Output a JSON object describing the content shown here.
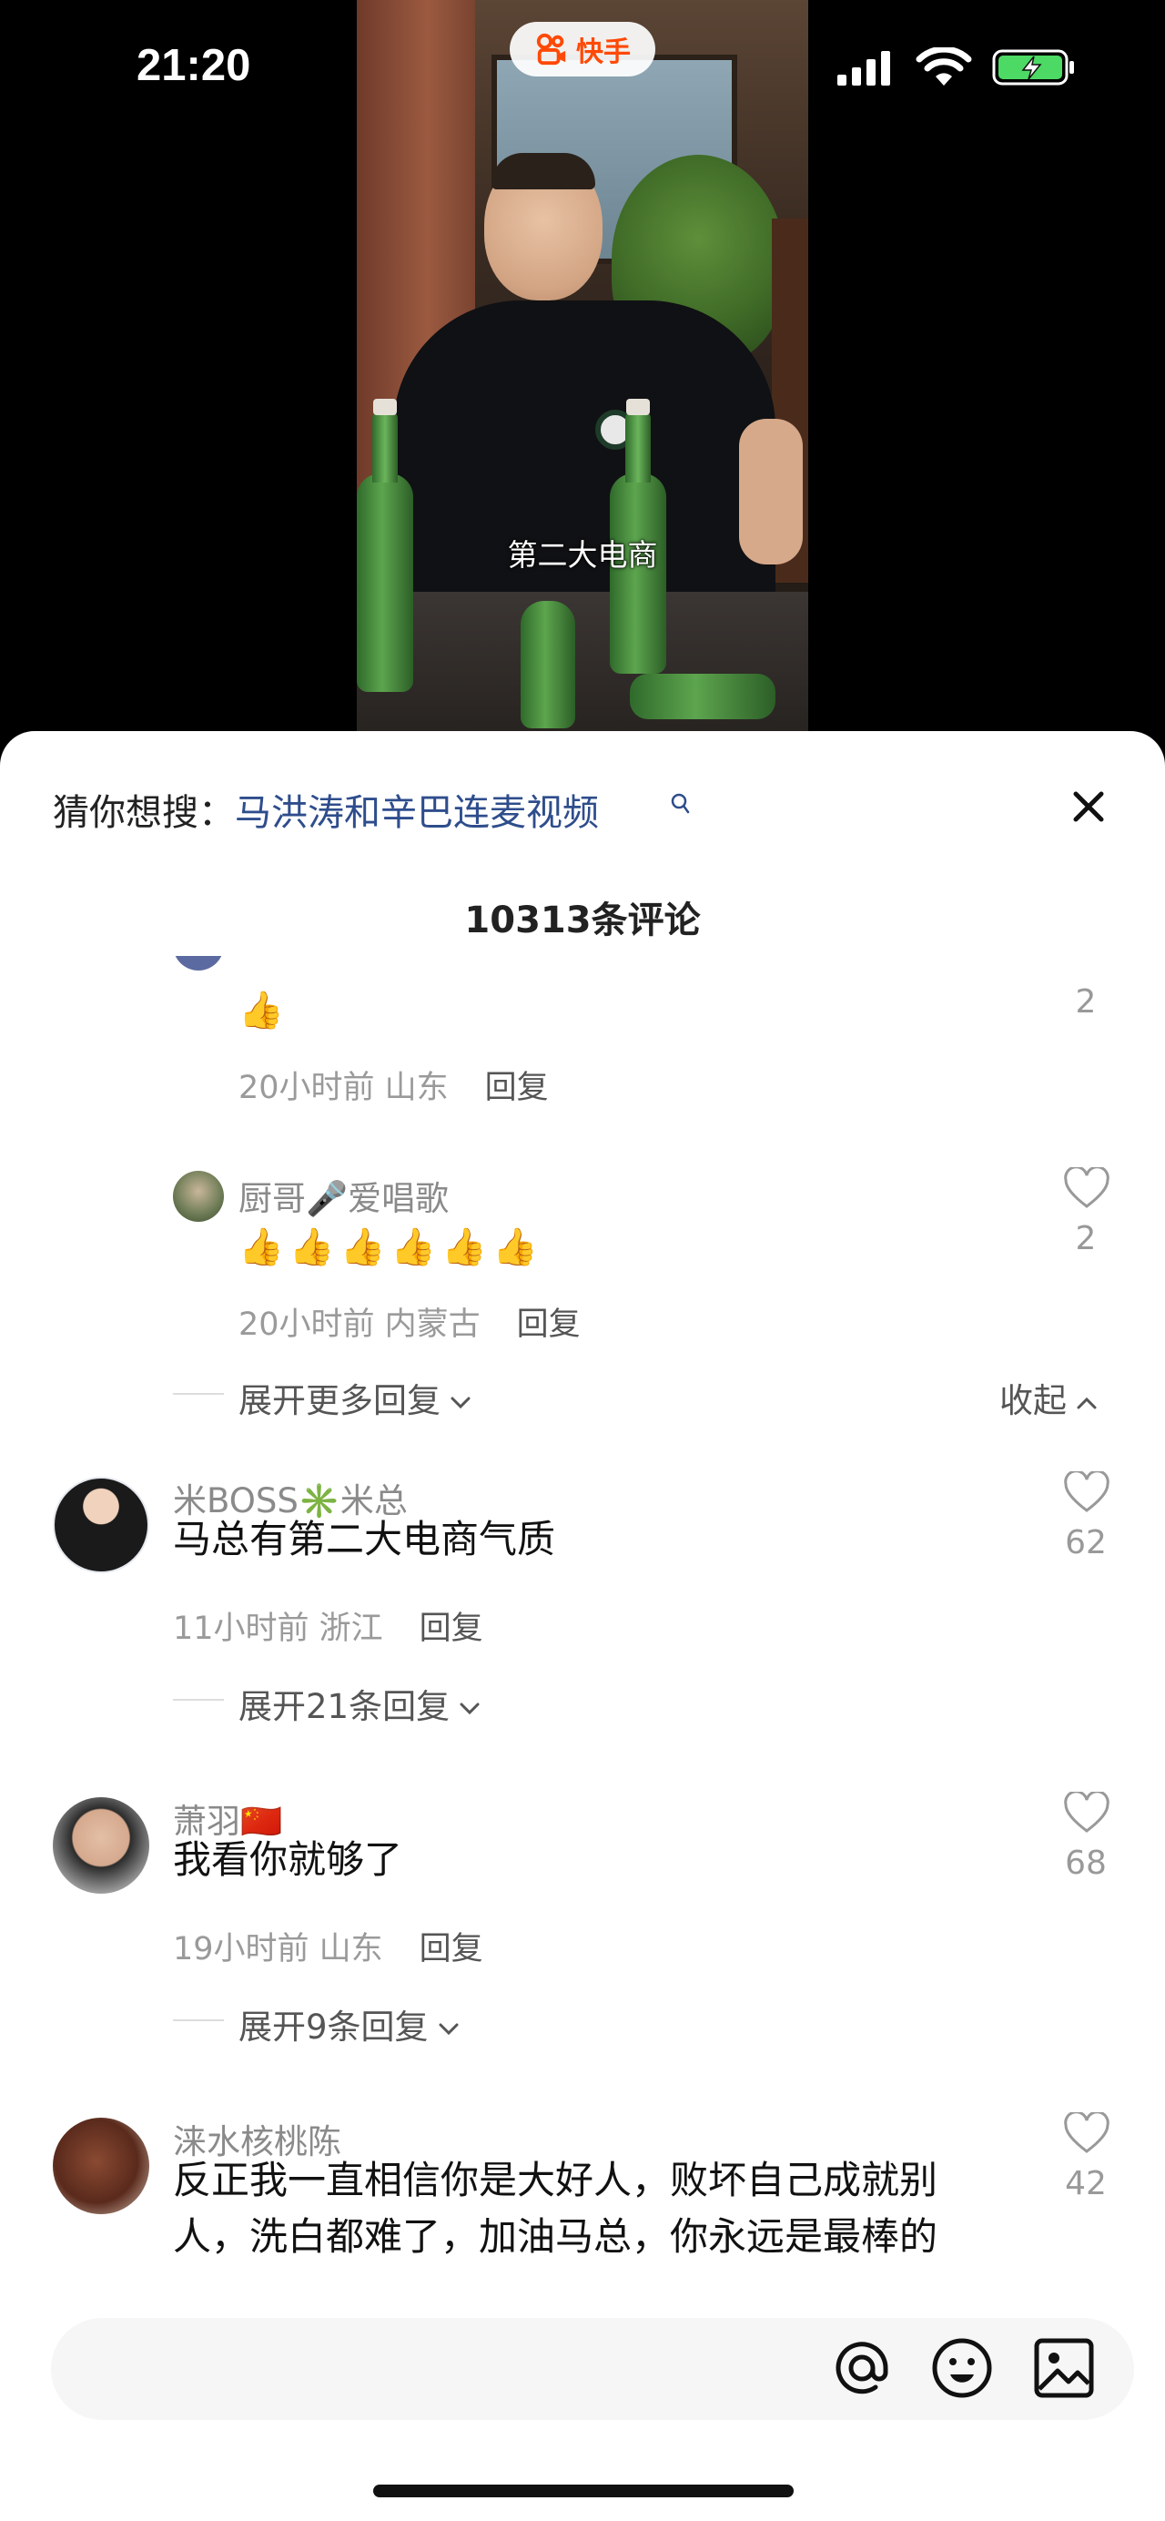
{
  "status_bar": {
    "time": "21:20"
  },
  "video": {
    "app_name": "快手",
    "subtitle": "第二大电商"
  },
  "sheet": {
    "guess_prefix": "猜你想搜：",
    "guess_query": "马洪涛和辛巴连麦视频",
    "comment_count": "10313条评论"
  },
  "comments": {
    "partial": {
      "emoji": "👍",
      "likes": "2",
      "meta_time": "20小时前 山东",
      "reply": "回复"
    },
    "reply1": {
      "name": "厨哥🎤爱唱歌",
      "emoji": "👍👍👍👍👍👍",
      "likes": "2",
      "meta_time": "20小时前 内蒙古",
      "reply": "回复"
    },
    "thread_controls": {
      "expand_more": "展开更多回复",
      "collapse": "收起"
    },
    "c1": {
      "name": "米BOSS✳️米总",
      "text": "马总有第二大电商气质",
      "likes": "62",
      "meta_time": "11小时前 浙江",
      "reply": "回复",
      "expand": "展开21条回复"
    },
    "c2": {
      "name": "萧羽🇨🇳",
      "text": "我看你就够了",
      "likes": "68",
      "meta_time": "19小时前 山东",
      "reply": "回复",
      "expand": "展开9条回复"
    },
    "c3": {
      "name": "涞水核桃陈",
      "text": "反正我一直相信你是大好人，败坏自己成就别人，洗白都难了，加油马总，你永远是最棒的",
      "likes": "42"
    }
  },
  "colors": {
    "accent_link": "#2e4d8c",
    "brand": "#ff4906"
  },
  "icons": [
    "kuaishou-logo-icon",
    "signal-icon",
    "wifi-icon",
    "battery-icon",
    "search-icon",
    "close-icon",
    "heart-icon",
    "chevron-down-icon",
    "chevron-up-icon",
    "at-icon",
    "emoji-icon",
    "image-icon"
  ]
}
